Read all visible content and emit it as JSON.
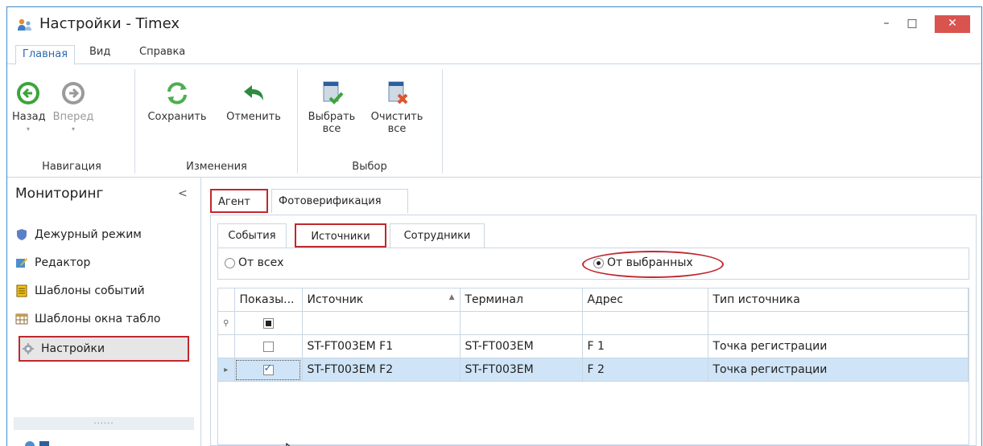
{
  "window": {
    "title": "Настройки - Timex",
    "close": "✕",
    "minimize": "–",
    "maximize": "□"
  },
  "menu_tabs": [
    "Главная",
    "Вид",
    "Справка"
  ],
  "ribbon": {
    "nav": {
      "back": "Назад",
      "forward": "Вперед",
      "group": "Навигация"
    },
    "changes": {
      "save": "Сохранить",
      "cancel": "Отменить",
      "group": "Изменения"
    },
    "select": {
      "select_all_1": "Выбрать",
      "select_all_2": "все",
      "clear_all_1": "Очистить",
      "clear_all_2": "все",
      "group": "Выбор"
    }
  },
  "sidebar": {
    "title": "Мониторинг",
    "items": [
      {
        "label": "Дежурный режим",
        "icon": "shield-icon"
      },
      {
        "label": "Редактор",
        "icon": "edit-icon"
      },
      {
        "label": "Шаблоны событий",
        "icon": "template-icon"
      },
      {
        "label": "Шаблоны окна табло",
        "icon": "table-icon"
      },
      {
        "label": "Настройки",
        "icon": "settings-icon"
      }
    ],
    "splitter": "......"
  },
  "top_tabs": [
    "Агент",
    "Фотоверификация"
  ],
  "sub_tabs": [
    "События",
    "Источники",
    "Сотрудники"
  ],
  "filter": {
    "from_all": "От всех",
    "from_selected": "От выбранных"
  },
  "grid": {
    "headers": [
      "Показы...",
      "Источник",
      "Терминал",
      "Адрес",
      "Тип источника"
    ],
    "rows": [
      {
        "show": false,
        "source": "ST-FT003EM F1",
        "terminal": "ST-FT003EM",
        "address": "F 1",
        "type": "Точка регистрации"
      },
      {
        "show": true,
        "source": "ST-FT003EM F2",
        "terminal": "ST-FT003EM",
        "address": "F 2",
        "type": "Точка регистрации"
      }
    ]
  },
  "colors": {
    "accent": "#2b6cb0",
    "highlight": "#c0282e",
    "selected_row": "#cfe4f7"
  }
}
